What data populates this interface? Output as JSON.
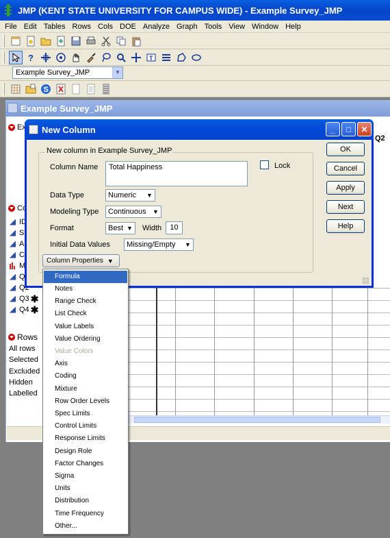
{
  "app": {
    "title": "JMP (KENT STATE UNIVERSITY FOR CAMPUS WIDE)  - Example Survey_JMP",
    "menu": [
      "File",
      "Edit",
      "Tables",
      "Rows",
      "Cols",
      "DOE",
      "Analyze",
      "Graph",
      "Tools",
      "View",
      "Window",
      "Help"
    ],
    "table_selector": "Example Survey_JMP"
  },
  "window": {
    "title": "Example Survey_JMP",
    "sections": {
      "table_panel": "Ex",
      "columns_panel": "Co",
      "rows_panel": "Rows"
    },
    "columns": [
      {
        "label": "ID",
        "icon": "continuous-icon"
      },
      {
        "label": "S",
        "icon": "continuous-icon"
      },
      {
        "label": "A",
        "icon": "continuous-icon"
      },
      {
        "label": "C",
        "icon": "continuous-icon"
      },
      {
        "label": "M",
        "icon": "nominal-icon"
      },
      {
        "label": "Q",
        "icon": "continuous-icon"
      },
      {
        "label": "Q2",
        "icon": "continuous-icon"
      },
      {
        "label": "Q3",
        "icon": "continuous-icon",
        "star": "✱"
      },
      {
        "label": "Q4",
        "icon": "continuous-icon",
        "star": "✱"
      }
    ],
    "rows": [
      "All rows",
      "Selected",
      "Excluded",
      "Hidden",
      "Labelled"
    ],
    "header_q2": "Q2"
  },
  "dialog": {
    "title": "New Column",
    "group_label": "New column in Example Survey_JMP",
    "column_name_label": "Column Name",
    "column_name_value": "Total Happiness",
    "lock_label": "Lock",
    "data_type_label": "Data Type",
    "data_type_value": "Numeric",
    "modeling_type_label": "Modeling Type",
    "modeling_type_value": "Continuous",
    "format_label": "Format",
    "format_value": "Best",
    "width_label": "Width",
    "width_value": "10",
    "initial_values_label": "Initial Data Values",
    "initial_values_value": "Missing/Empty",
    "column_properties_label": "Column Properties",
    "buttons": {
      "ok": "OK",
      "cancel": "Cancel",
      "apply": "Apply",
      "next": "Next",
      "help": "Help"
    }
  },
  "menu_items": [
    "Formula",
    "Notes",
    "Range Check",
    "List Check",
    "Value Labels",
    "Value Ordering",
    "Value Colors",
    "Axis",
    "Coding",
    "Mixture",
    "Row Order Levels",
    "Spec Limits",
    "Control Limits",
    "Response Limits",
    "Design Role",
    "Factor Changes",
    "Sigma",
    "Units",
    "Distribution",
    "Time Frequency",
    "Other..."
  ],
  "menu_state": {
    "selected": "Formula",
    "disabled": [
      "Value Colors"
    ]
  }
}
